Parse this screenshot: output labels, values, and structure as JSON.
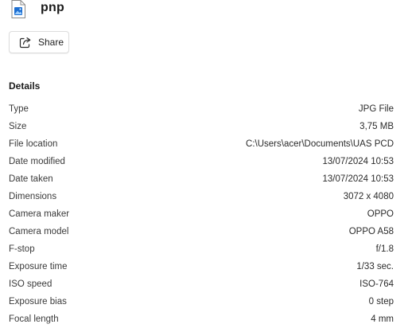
{
  "file": {
    "name": "pnp",
    "icon": "image-file-icon"
  },
  "share": {
    "label": "Share",
    "icon": "share-icon"
  },
  "details": {
    "title": "Details",
    "rows": [
      {
        "label": "Type",
        "value": "JPG File"
      },
      {
        "label": "Size",
        "value": "3,75 MB"
      },
      {
        "label": "File location",
        "value": "C:\\Users\\acer\\Documents\\UAS PCD"
      },
      {
        "label": "Date modified",
        "value": "13/07/2024 10:53"
      },
      {
        "label": "Date taken",
        "value": "13/07/2024 10:53"
      },
      {
        "label": "Dimensions",
        "value": "3072 x 4080"
      },
      {
        "label": "Camera maker",
        "value": "OPPO"
      },
      {
        "label": "Camera model",
        "value": "OPPO A58"
      },
      {
        "label": "F-stop",
        "value": "f/1.8"
      },
      {
        "label": "Exposure time",
        "value": "1/33 sec."
      },
      {
        "label": "ISO speed",
        "value": "ISO-764"
      },
      {
        "label": "Exposure bias",
        "value": "0 step"
      },
      {
        "label": "Focal length",
        "value": "4 mm"
      }
    ]
  },
  "colors": {
    "icon_blue": "#1e6fd1",
    "border": "#dcdcdc"
  }
}
